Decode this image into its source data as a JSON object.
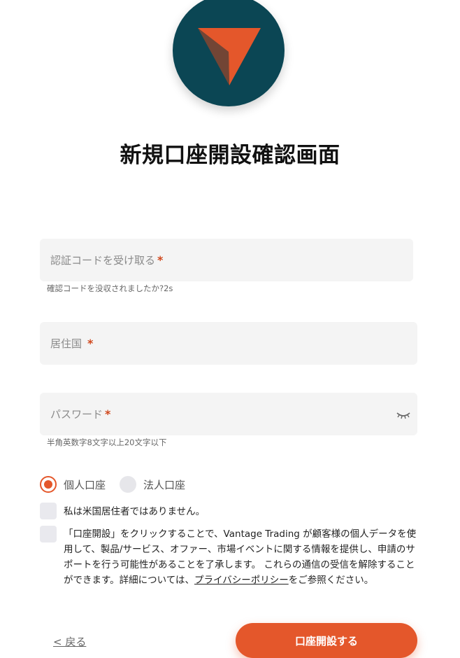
{
  "brand": {
    "accent": "#e4572b",
    "logo_bg": "#0b4654",
    "logo_icon": "arrow-pointer-icon"
  },
  "page": {
    "title": "新規口座開設確認画面"
  },
  "form": {
    "code": {
      "label": "認証コードを受け取る",
      "required": "*",
      "hint": "確認コードを没収されましたか?2s"
    },
    "country": {
      "label": "居住国",
      "required": "*"
    },
    "password": {
      "label": "パスワード",
      "required": "*",
      "hint": "半角英数字8文字以上20文字以下",
      "toggle_icon": "eye-closed-icon"
    },
    "account_type": {
      "options": [
        {
          "label": "個人口座",
          "selected": true
        },
        {
          "label": "法人口座",
          "selected": false
        }
      ]
    },
    "checks": {
      "us_resident": "私は米国居住者ではありません。",
      "consent_before": "「口座開設」をクリックすることで、Vantage Trading が顧客様の個人データを使用して、製品/サービス、オファー、市場イベントに関する情報を提供し、申請のサポートを行う可能性があることを了承します。 これらの通信の受信を解除することができます。詳細については、",
      "consent_link": "プライバシーポリシー",
      "consent_after": "をご参照ください。"
    }
  },
  "actions": {
    "back": "< 戻る",
    "submit": "口座開設する"
  }
}
